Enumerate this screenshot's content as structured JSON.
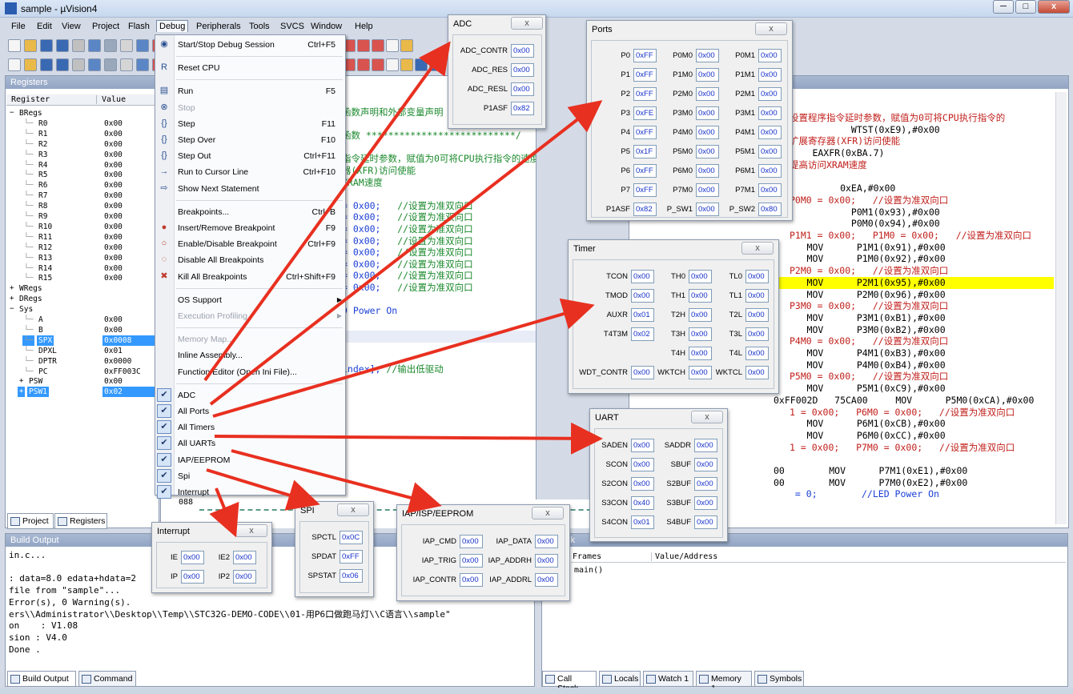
{
  "window": {
    "title": "sample - µVision4",
    "icon": "uvision-icon",
    "min": "─",
    "max": "□",
    "close": "x"
  },
  "menubar": [
    "File",
    "Edit",
    "View",
    "Project",
    "Flash",
    "Debug",
    "Peripherals",
    "Tools",
    "SVCS",
    "Window",
    "Help"
  ],
  "registers": {
    "title": "Registers",
    "headers": [
      "Register",
      "Value"
    ],
    "rows": [
      {
        "n": "BRegs",
        "v": "",
        "indent": 0,
        "exp": "−"
      },
      {
        "n": "R0",
        "v": "0x00",
        "indent": 2
      },
      {
        "n": "R1",
        "v": "0x00",
        "indent": 2
      },
      {
        "n": "R2",
        "v": "0x00",
        "indent": 2
      },
      {
        "n": "R3",
        "v": "0x00",
        "indent": 2
      },
      {
        "n": "R4",
        "v": "0x00",
        "indent": 2
      },
      {
        "n": "R5",
        "v": "0x00",
        "indent": 2
      },
      {
        "n": "R6",
        "v": "0x00",
        "indent": 2
      },
      {
        "n": "R7",
        "v": "0x00",
        "indent": 2
      },
      {
        "n": "R8",
        "v": "0x00",
        "indent": 2
      },
      {
        "n": "R9",
        "v": "0x00",
        "indent": 2
      },
      {
        "n": "R10",
        "v": "0x00",
        "indent": 2
      },
      {
        "n": "R11",
        "v": "0x00",
        "indent": 2
      },
      {
        "n": "R12",
        "v": "0x00",
        "indent": 2
      },
      {
        "n": "R13",
        "v": "0x00",
        "indent": 2
      },
      {
        "n": "R14",
        "v": "0x00",
        "indent": 2
      },
      {
        "n": "R15",
        "v": "0x00",
        "indent": 2
      },
      {
        "n": "WRegs",
        "v": "",
        "indent": 0,
        "exp": "+"
      },
      {
        "n": "DRegs",
        "v": "",
        "indent": 0,
        "exp": "+"
      },
      {
        "n": "Sys",
        "v": "",
        "indent": 0,
        "exp": "−"
      },
      {
        "n": "A",
        "v": "0x00",
        "indent": 2
      },
      {
        "n": "B",
        "v": "0x00",
        "indent": 2
      },
      {
        "n": "SPX",
        "v": "0x0008",
        "indent": 2,
        "sel": true
      },
      {
        "n": "DPXL",
        "v": "0x01",
        "indent": 2
      },
      {
        "n": "DPTR",
        "v": "0x0000",
        "indent": 2
      },
      {
        "n": "PC",
        "v": "0xFF003C",
        "indent": 2
      },
      {
        "n": "PSW",
        "v": "0x00",
        "indent": 1,
        "exp": "+"
      },
      {
        "n": "PSW1",
        "v": "0x02",
        "indent": 1,
        "exp": "+",
        "sel": true
      }
    ],
    "tabs": [
      "Project",
      "Registers"
    ]
  },
  "code_left": [
    {
      "t": "函数声明和外部变量声明 ******/",
      "c": "green"
    },
    {
      "t": "",
      "c": ""
    },
    {
      "t": "函数 ***************************/",
      "c": "green"
    },
    {
      "t": "",
      "c": ""
    },
    {
      "t": "指令延时参数，赋值为0可将CPU执行指令的速度",
      "c": "green"
    },
    {
      "t": "器(XFR)访问使能",
      "c": "green"
    },
    {
      "t": "XRAM速度",
      "c": "green"
    },
    {
      "t": "",
      "c": ""
    },
    {
      "t": "= 0x00;   //设置为准双向口",
      "c": "mix"
    },
    {
      "t": "= 0x00;   //设置为准双向口",
      "c": "mix"
    },
    {
      "t": "= 0x00;   //设置为准双向口",
      "c": "mix"
    },
    {
      "t": "= 0x00;   //设置为准双向口",
      "c": "mix"
    },
    {
      "t": "= 0x00;   //设置为准双向口",
      "c": "mix"
    },
    {
      "t": "= 0x00;   //设置为准双向口",
      "c": "mix"
    },
    {
      "t": "= 0x00;   //设置为准双向口",
      "c": "mix"
    },
    {
      "t": "= 0x00;   //设置为准双向口",
      "c": "mix"
    },
    {
      "t": "",
      "c": ""
    },
    {
      "t": "D Power On",
      "c": "blue"
    },
    {
      "t": "",
      "c": ""
    },
    {
      "t": "",
      "c": ""
    },
    {
      "t": "",
      "c": ""
    },
    {
      "t": "",
      "c": ""
    },
    {
      "t": "index]; //输出低驱动",
      "c": "mix"
    }
  ],
  "disasm": {
    "rows": [
      {
        "t": "设置程序指令延时参数，赋值为0可将CPU执行指令的",
        "c": "red"
      },
      {
        "t": "              WTST(0xE9),#0x00",
        "c": ""
      },
      {
        "t": "扩展寄存器(XFR)访问使能",
        "c": "red"
      },
      {
        "t": "TB     EAXFR(0xBA.7)",
        "c": ""
      },
      {
        "t": "提高访问XRAM速度",
        "c": "red"
      },
      {
        "t": "",
        "c": ""
      },
      {
        "t": "7           0xEA,#0x00",
        "c": ""
      },
      {
        "t": "P0M0 = 0x00;   //设置为准双向口",
        "c": "red"
      },
      {
        "t": "              P0M1(0x93),#0x00",
        "c": ""
      },
      {
        "t": "              P0M0(0x94),#0x00",
        "c": ""
      },
      {
        "t": "P1M1 = 0x00;   P1M0 = 0x00;   //设置为准双向口",
        "c": "red"
      },
      {
        "t": "      MOV      P1M1(0x91),#0x00",
        "c": ""
      },
      {
        "t": "      MOV      P1M0(0x92),#0x00",
        "c": ""
      },
      {
        "t": "P2M0 = 0x00;   //设置为准双向口",
        "c": "red"
      },
      {
        "t": "      MOV      P2M1(0x95),#0x00",
        "c": "hl"
      },
      {
        "t": "      MOV      P2M0(0x96),#0x00",
        "c": ""
      },
      {
        "t": "P3M0 = 0x00;   //设置为准双向口",
        "c": "red"
      },
      {
        "t": "      MOV      P3M1(0xB1),#0x00",
        "c": ""
      },
      {
        "t": "      MOV      P3M0(0xB2),#0x00",
        "c": ""
      },
      {
        "t": "P4M0 = 0x00;   //设置为准双向口",
        "c": "red"
      },
      {
        "t": "      MOV      P4M1(0xB3),#0x00",
        "c": ""
      },
      {
        "t": "      MOV      P4M0(0xB4),#0x00",
        "c": ""
      },
      {
        "t": "P5M0 = 0x00;   //设置为准双向口",
        "c": "red"
      },
      {
        "t": "      MOV      P5M1(0xC9),#0x00",
        "c": ""
      },
      {
        "t": "0xFF002D   75CA00     MOV      P5M0(0xCA),#0x00",
        "c": ""
      },
      {
        "t": "1 = 0x00;   P6M0 = 0x00;   //设置为准双向口",
        "c": "red"
      },
      {
        "t": "      MOV      P6M1(0xCB),#0x00",
        "c": ""
      },
      {
        "t": "      MOV      P6M0(0xCC),#0x00",
        "c": ""
      },
      {
        "t": "1 = 0x00;   P7M0 = 0x00;   //设置为准双向口",
        "c": "red"
      },
      {
        "t": "",
        "c": ""
      },
      {
        "t": "00        MOV      P7M1(0xE1),#0x00",
        "c": ""
      },
      {
        "t": "00        MOV      P7M0(0xE2),#0x00",
        "c": ""
      },
      {
        "t": " = 0;        //LED Power On",
        "c": "blue"
      }
    ],
    "line_no": "088"
  },
  "menu": {
    "items": [
      {
        "k": "item",
        "label": "Start/Stop Debug Session",
        "key": "Ctrl+F5",
        "icon": "debug-session-icon",
        "ig": "◉"
      },
      {
        "k": "sep"
      },
      {
        "k": "item",
        "label": "Reset CPU",
        "key": "",
        "icon": "reset-cpu-icon",
        "ig": "R"
      },
      {
        "k": "sep"
      },
      {
        "k": "item",
        "label": "Run",
        "key": "F5",
        "icon": "run-icon",
        "ig": "▤"
      },
      {
        "k": "item",
        "label": "Stop",
        "key": "",
        "icon": "stop-icon",
        "ig": "⊗",
        "dis": true
      },
      {
        "k": "item",
        "label": "Step",
        "key": "F11",
        "icon": "step-icon",
        "ig": "{}"
      },
      {
        "k": "item",
        "label": "Step Over",
        "key": "F10",
        "icon": "step-over-icon",
        "ig": "{}"
      },
      {
        "k": "item",
        "label": "Step Out",
        "key": "Ctrl+F11",
        "icon": "step-out-icon",
        "ig": "{}"
      },
      {
        "k": "item",
        "label": "Run to Cursor Line",
        "key": "Ctrl+F10",
        "icon": "run-to-cursor-icon",
        "ig": "→"
      },
      {
        "k": "item",
        "label": "Show Next Statement",
        "key": "",
        "icon": "next-statement-icon",
        "ig": "⇨"
      },
      {
        "k": "sep"
      },
      {
        "k": "item",
        "label": "Breakpoints...",
        "key": "Ctrl+B",
        "icon": "",
        "ig": ""
      },
      {
        "k": "item",
        "label": "Insert/Remove Breakpoint",
        "key": "F9",
        "icon": "breakpoint-icon",
        "ig": "●"
      },
      {
        "k": "item",
        "label": "Enable/Disable Breakpoint",
        "key": "Ctrl+F9",
        "icon": "enable-breakpoint-icon",
        "ig": "○"
      },
      {
        "k": "item",
        "label": "Disable All Breakpoints",
        "key": "",
        "icon": "disable-breakpoints-icon",
        "ig": "◌"
      },
      {
        "k": "item",
        "label": "Kill All Breakpoints",
        "key": "Ctrl+Shift+F9",
        "icon": "kill-breakpoints-icon",
        "ig": "✖"
      },
      {
        "k": "sep"
      },
      {
        "k": "item",
        "label": "OS Support",
        "key": "",
        "sub": true
      },
      {
        "k": "item",
        "label": "Execution Profiling",
        "key": "",
        "sub": true,
        "dis": true
      },
      {
        "k": "sep"
      },
      {
        "k": "item",
        "label": "Memory Map...",
        "key": "",
        "dis": true
      },
      {
        "k": "item",
        "label": "Inline Assembly...",
        "key": ""
      },
      {
        "k": "item",
        "label": "Function Editor (Open Ini File)...",
        "key": ""
      },
      {
        "k": "sep"
      },
      {
        "k": "item",
        "label": "ADC",
        "key": "",
        "chk": true
      },
      {
        "k": "item",
        "label": "All Ports",
        "key": "",
        "chk": true
      },
      {
        "k": "item",
        "label": "All Timers",
        "key": "",
        "chk": true
      },
      {
        "k": "item",
        "label": "All UARTs",
        "key": "",
        "chk": true
      },
      {
        "k": "item",
        "label": "IAP/EEPROM",
        "key": "",
        "chk": true
      },
      {
        "k": "item",
        "label": "Spi",
        "key": "",
        "chk": true
      },
      {
        "k": "item",
        "label": "Interrupt",
        "key": "",
        "chk": true
      }
    ]
  },
  "build": {
    "title": "Build Output",
    "lines": [
      "in.c...",
      "",
      ": data=8.0 edata+hdata=2",
      "file from \"sample\"...",
      "Error(s), 0 Warning(s).",
      "ers\\\\Administrator\\\\Desktop\\\\Temp\\\\STC32G-DEMO-CODE\\\\01-用P6口做跑马灯\\\\C语言\\\\sample\"",
      "on    : V1.08",
      "sion : V4.0",
      "Done ."
    ],
    "tabs": [
      "Build Output",
      "Command"
    ]
  },
  "callstack": {
    "title": "ck",
    "headers": [
      "Frames",
      "Value/Address"
    ],
    "rows": [
      [
        "main()",
        ""
      ]
    ],
    "tabs": [
      "Call Stack",
      "Locals",
      "Watch 1",
      "Memory 1",
      "Symbols"
    ]
  },
  "windows": {
    "adc": {
      "title": "ADC",
      "fields": [
        {
          "l": "ADC_CONTR",
          "v": "0x00"
        },
        {
          "l": "ADC_RES",
          "v": "0x00"
        },
        {
          "l": "ADC_RESL",
          "v": "0x00"
        },
        {
          "l": "P1ASF",
          "v": "0x82"
        }
      ]
    },
    "ports": {
      "title": "Ports",
      "rows": [
        [
          {
            "l": "P0",
            "v": "0xFF"
          },
          {
            "l": "P0M0",
            "v": "0x00"
          },
          {
            "l": "P0M1",
            "v": "0x00"
          }
        ],
        [
          {
            "l": "P1",
            "v": "0xFF"
          },
          {
            "l": "P1M0",
            "v": "0x00"
          },
          {
            "l": "P1M1",
            "v": "0x00"
          }
        ],
        [
          {
            "l": "P2",
            "v": "0xFF"
          },
          {
            "l": "P2M0",
            "v": "0x00"
          },
          {
            "l": "P2M1",
            "v": "0x00"
          }
        ],
        [
          {
            "l": "P3",
            "v": "0xFE"
          },
          {
            "l": "P3M0",
            "v": "0x00"
          },
          {
            "l": "P3M1",
            "v": "0x00"
          }
        ],
        [
          {
            "l": "P4",
            "v": "0xFF"
          },
          {
            "l": "P4M0",
            "v": "0x00"
          },
          {
            "l": "P4M1",
            "v": "0x00"
          }
        ],
        [
          {
            "l": "P5",
            "v": "0x1F"
          },
          {
            "l": "P5M0",
            "v": "0x00"
          },
          {
            "l": "P5M1",
            "v": "0x00"
          }
        ],
        [
          {
            "l": "P6",
            "v": "0xFF"
          },
          {
            "l": "P6M0",
            "v": "0x00"
          },
          {
            "l": "P6M1",
            "v": "0x00"
          }
        ],
        [
          {
            "l": "P7",
            "v": "0xFF"
          },
          {
            "l": "P7M0",
            "v": "0x00"
          },
          {
            "l": "P7M1",
            "v": "0x00"
          }
        ],
        [
          {
            "l": "P1ASF",
            "v": "0x82"
          },
          {
            "l": "P_SW1",
            "v": "0x00"
          },
          {
            "l": "P_SW2",
            "v": "0x80"
          }
        ]
      ]
    },
    "timer": {
      "title": "Timer",
      "rows": [
        [
          {
            "l": "TCON",
            "v": "0x00"
          },
          {
            "l": "TH0",
            "v": "0x00"
          },
          {
            "l": "TL0",
            "v": "0x00"
          }
        ],
        [
          {
            "l": "TMOD",
            "v": "0x00"
          },
          {
            "l": "TH1",
            "v": "0x00"
          },
          {
            "l": "TL1",
            "v": "0x00"
          }
        ],
        [
          {
            "l": "AUXR",
            "v": "0x01"
          },
          {
            "l": "T2H",
            "v": "0x00"
          },
          {
            "l": "T2L",
            "v": "0x00"
          }
        ],
        [
          {
            "l": "T4T3M",
            "v": "0x02"
          },
          {
            "l": "T3H",
            "v": "0x00"
          },
          {
            "l": "T3L",
            "v": "0x00"
          }
        ],
        [
          null,
          {
            "l": "T4H",
            "v": "0x00"
          },
          {
            "l": "T4L",
            "v": "0x00"
          }
        ],
        [
          {
            "l": "WDT_CONTR",
            "v": "0x00"
          },
          {
            "l": "WKTCH",
            "v": "0x00"
          },
          {
            "l": "WKTCL",
            "v": "0x00"
          }
        ]
      ]
    },
    "uart": {
      "title": "UART",
      "rows": [
        [
          {
            "l": "SADEN",
            "v": "0x00"
          },
          {
            "l": "SADDR",
            "v": "0x00"
          }
        ],
        [
          {
            "l": "SCON",
            "v": "0x00"
          },
          {
            "l": "SBUF",
            "v": "0x00"
          }
        ],
        [
          {
            "l": "S2CON",
            "v": "0x00"
          },
          {
            "l": "S2BUF",
            "v": "0x00"
          }
        ],
        [
          {
            "l": "S3CON",
            "v": "0x40"
          },
          {
            "l": "S3BUF",
            "v": "0x00"
          }
        ],
        [
          {
            "l": "S4CON",
            "v": "0x01"
          },
          {
            "l": "S4BUF",
            "v": "0x00"
          }
        ]
      ]
    },
    "interrupt": {
      "title": "Interrupt",
      "rows": [
        [
          {
            "l": "IE",
            "v": "0x00"
          },
          {
            "l": "IE2",
            "v": "0x00"
          }
        ],
        [
          {
            "l": "IP",
            "v": "0x00"
          },
          {
            "l": "IP2",
            "v": "0x00"
          }
        ]
      ]
    },
    "spi": {
      "title": "SPI",
      "fields": [
        {
          "l": "SPCTL",
          "v": "0x0C"
        },
        {
          "l": "SPDAT",
          "v": "0xFF"
        },
        {
          "l": "SPSTAT",
          "v": "0x06"
        }
      ]
    },
    "iap": {
      "title": "IAP/ISP/EEPROM",
      "rows": [
        [
          {
            "l": "IAP_CMD",
            "v": "0x00"
          },
          {
            "l": "IAP_DATA",
            "v": "0x00"
          }
        ],
        [
          {
            "l": "IAP_TRIG",
            "v": "0x00"
          },
          {
            "l": "IAP_ADDRH",
            "v": "0x00"
          }
        ],
        [
          {
            "l": "IAP_CONTR",
            "v": "0x00"
          },
          {
            "l": "IAP_ADDRL",
            "v": "0x00"
          }
        ]
      ]
    },
    "close_label": "x"
  },
  "colors": {
    "accent": "#3399ff",
    "arrow": "#e83020",
    "field_text": "#1530c8",
    "highlight": "#ffff00"
  }
}
